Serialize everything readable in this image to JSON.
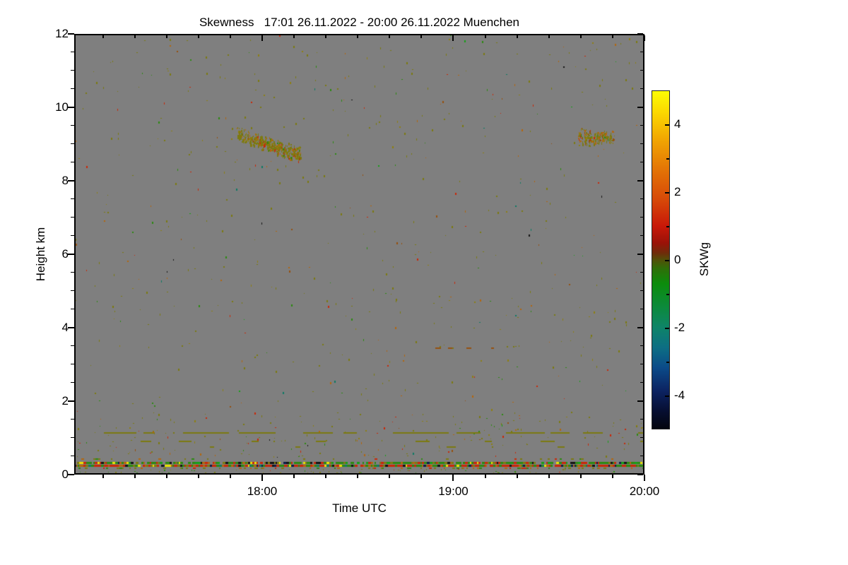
{
  "figure": {
    "title": "Skewness   17:01 26.11.2022 - 20:00 26.11.2022 Muenchen"
  },
  "chart_data": {
    "type": "heatmap",
    "title": "Skewness   17:01 26.11.2022 - 20:00 26.11.2022 Muenchen",
    "xlabel": "Time UTC",
    "ylabel": "Height km",
    "site": "Muenchen",
    "date": "26.11.2022",
    "x_range": [
      "17:01",
      "20:00"
    ],
    "x_major_ticks": [
      "18:00",
      "19:00",
      "20:00"
    ],
    "x_minor_step_min": 10,
    "y_range": [
      0,
      12
    ],
    "y_major_ticks": [
      0,
      2,
      4,
      6,
      8,
      10,
      12
    ],
    "y_minor_step": 0.5,
    "grid": false,
    "no_data_color": "#7f7f7f",
    "colorbar": {
      "label": "SKWg",
      "min": -5,
      "max": 5,
      "labeled_ticks": [
        4,
        2,
        0,
        -2,
        -4
      ],
      "tick_step": 1,
      "stops": [
        [
          5.0,
          "#fdfd04"
        ],
        [
          4.4,
          "#fcda00"
        ],
        [
          3.6,
          "#f2a802"
        ],
        [
          2.6,
          "#e27006"
        ],
        [
          1.8,
          "#d74a08"
        ],
        [
          1.0,
          "#c81808"
        ],
        [
          0.5,
          "#9a1208"
        ],
        [
          0.2,
          "#6e2c0a"
        ],
        [
          0.0,
          "#515008"
        ],
        [
          -0.25,
          "#2f6e08"
        ],
        [
          -0.7,
          "#0c8c0c"
        ],
        [
          -1.4,
          "#0c8a3c"
        ],
        [
          -2.0,
          "#0e8468"
        ],
        [
          -2.6,
          "#0d6e84"
        ],
        [
          -3.2,
          "#0b4a88"
        ],
        [
          -3.9,
          "#0c2260"
        ],
        [
          -4.5,
          "#060e30"
        ],
        [
          -5.0,
          "#03050e"
        ]
      ]
    },
    "palette": {
      "olive": "#7c7a10",
      "dark_yellow": "#8e7f12",
      "orange": "#b2660e",
      "brown": "#96500e",
      "red": "#c92808",
      "dark_red": "#8c1a08",
      "green": "#2c8a10",
      "bright_green": "#16a016",
      "teal": "#0e7a64",
      "yellow": "#e8e000",
      "dark": "#141414",
      "navy": "#0d1c4a"
    },
    "seed": 20221126,
    "features": [
      {
        "kind": "noise",
        "label": "sparse-clear-air-speckle",
        "count": 620,
        "height": [
          0.5,
          12.0
        ],
        "size_w": [
          1,
          2
        ],
        "size_h": [
          1,
          3
        ],
        "weights": {
          "olive": 0.5,
          "dark_yellow": 0.12,
          "orange": 0.12,
          "brown": 0.04,
          "red": 0.07,
          "green": 0.09,
          "bright_green": 0.03,
          "dark": 0.01,
          "teal": 0.02
        }
      },
      {
        "kind": "noise",
        "label": "low-level-extra-speckle",
        "count": 110,
        "height": [
          0.45,
          1.7
        ],
        "size_w": [
          1,
          2
        ],
        "size_h": [
          1,
          2
        ],
        "weights": {
          "olive": 0.55,
          "dark_yellow": 0.15,
          "orange": 0.1,
          "red": 0.08,
          "green": 0.1,
          "dark": 0.02
        }
      },
      {
        "kind": "cloud",
        "label": "descending-cloud-layer",
        "time": [
          "17:52",
          "18:12"
        ],
        "h_top": [
          9.5,
          8.95
        ],
        "h_bot": [
          9.1,
          8.45
        ],
        "count": 420,
        "weights": {
          "olive": 0.6,
          "dark_yellow": 0.12,
          "orange": 0.14,
          "brown": 0.05,
          "red": 0.04,
          "green": 0.05
        }
      },
      {
        "kind": "cloud",
        "label": "cloud-patch",
        "time": [
          "19:39",
          "19:50"
        ],
        "h_top": [
          9.45,
          9.4
        ],
        "h_bot": [
          8.95,
          9.0
        ],
        "count": 150,
        "weights": {
          "olive": 0.58,
          "dark_yellow": 0.12,
          "orange": 0.16,
          "brown": 0.05,
          "red": 0.05,
          "green": 0.04
        }
      },
      {
        "kind": "dash_line",
        "label": "aerosol-layer-1.15km",
        "height": 1.15,
        "thickness": 2,
        "dash": [
          15,
          85
        ],
        "gap": [
          6,
          55
        ],
        "color": "olive",
        "fleck": true,
        "fleck_prob": 0.25,
        "fleck_weights": {
          "red": 0.4,
          "green": 0.35,
          "orange": 0.25
        }
      },
      {
        "kind": "dash_line",
        "label": "aerosol-layer-0.92km",
        "height": 0.92,
        "thickness": 2,
        "dash": [
          8,
          20
        ],
        "gap": [
          30,
          130
        ],
        "color": "olive",
        "fleck": false,
        "fleck_prob": 0,
        "fleck_weights": {}
      },
      {
        "kind": "dash_line",
        "label": "aerosol-layer-0.76km",
        "height": 0.76,
        "thickness": 2,
        "dash": [
          6,
          14
        ],
        "gap": [
          60,
          220
        ],
        "color": "olive",
        "fleck": false,
        "fleck_prob": 0,
        "fleck_weights": {}
      },
      {
        "kind": "dash_line",
        "label": "thin-layer-3.5km",
        "height": 3.47,
        "thickness": 2,
        "time": [
          "18:48",
          "19:12"
        ],
        "dash": [
          3,
          9
        ],
        "gap": [
          8,
          40
        ],
        "color": "brown",
        "fleck": true,
        "fleck_prob": 0.3,
        "fleck_weights": {
          "orange": 0.5,
          "olive": 0.3,
          "green": 0.2
        }
      },
      {
        "kind": "band_row",
        "label": "above-surface-sparse",
        "height": 0.45,
        "thickness": 2,
        "cell": [
          2,
          4
        ],
        "coverage": 0.1,
        "weights": {
          "olive": 0.6,
          "green": 0.2,
          "red": 0.1,
          "orange": 0.1
        }
      },
      {
        "kind": "band_row",
        "label": "surface-band-top",
        "height": 0.345,
        "thickness": 3,
        "cell": [
          2,
          4
        ],
        "coverage": 0.88,
        "weights": {
          "green": 0.36,
          "red": 0.2,
          "olive": 0.12,
          "dark": 0.08,
          "yellow": 0.07,
          "orange": 0.08,
          "bright_green": 0.06,
          "navy": 0.03
        }
      },
      {
        "kind": "band_row",
        "label": "surface-band-main",
        "height": 0.27,
        "thickness": 3,
        "cell": [
          2,
          4
        ],
        "coverage": 0.97,
        "weights": {
          "red": 0.38,
          "orange": 0.16,
          "green": 0.23,
          "dark": 0.05,
          "yellow": 0.05,
          "olive": 0.06,
          "teal": 0.04,
          "navy": 0.03
        }
      },
      {
        "kind": "band_row",
        "label": "surface-band-bottom",
        "height": 0.2,
        "thickness": 2,
        "cell": [
          2,
          4
        ],
        "coverage": 0.28,
        "weights": {
          "olive": 0.4,
          "green": 0.3,
          "red": 0.15,
          "orange": 0.15
        }
      },
      {
        "kind": "noise",
        "label": "below-band-speckle",
        "count": 70,
        "height": [
          0.04,
          0.16
        ],
        "size_w": [
          1,
          2
        ],
        "size_h": [
          1,
          2
        ],
        "weights": {
          "olive": 0.5,
          "green": 0.25,
          "dark_yellow": 0.15,
          "red": 0.1
        }
      }
    ]
  }
}
